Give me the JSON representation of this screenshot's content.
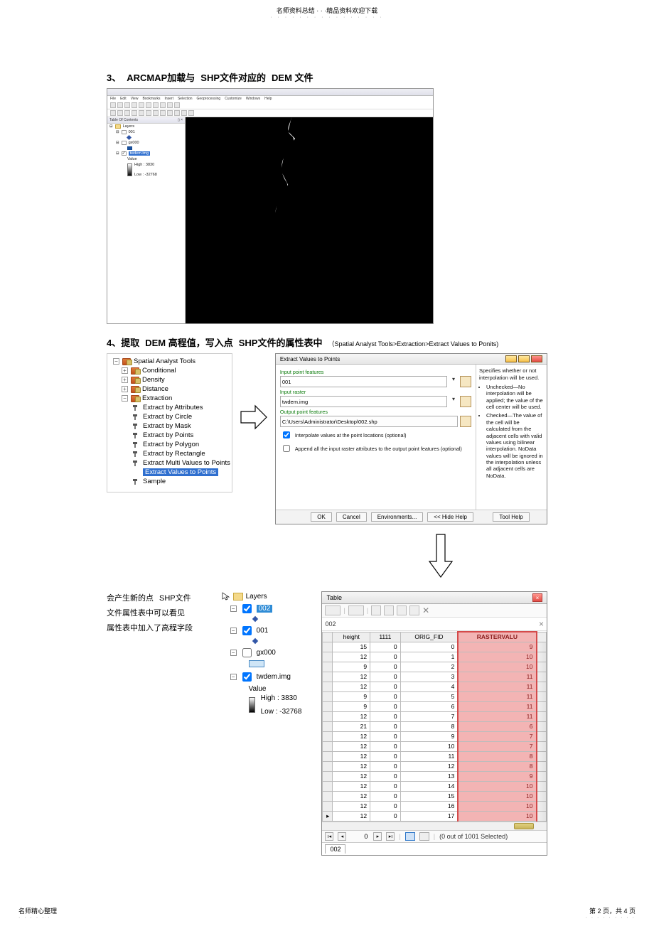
{
  "page_header": {
    "line1": "名师资料总结 · · ·精品资料欢迎下载",
    "sub": "· · · · · · · · · · · · · · · ·"
  },
  "step3": {
    "num": "3、",
    "seg1": "ARCMAP加载与",
    "seg2": "SHP文件对应的",
    "seg3": "DEM 文件"
  },
  "arcmap": {
    "menu": [
      "File",
      "Edit",
      "View",
      "Bookmarks",
      "Insert",
      "Selection",
      "Geoprocessing",
      "Customize",
      "Windows",
      "Help"
    ],
    "toc_title": "Table Of Contents",
    "toc_pin": "▯ ×",
    "layers_label": "Layers",
    "item1": "001",
    "item2": "gx000",
    "sel_item": "twdem.img",
    "value_label": "Value",
    "high": "High : 3830",
    "low": "Low : -32768"
  },
  "step4": {
    "num": "4、提取",
    "seg1": "DEM 高程值，写入点",
    "seg2": "SHP文件的属性表中",
    "note": "（Spatial Analyst Tools>Extraction>Extract Values to Ponits)"
  },
  "toolbox": {
    "root": "Spatial Analyst Tools",
    "groups": [
      "Conditional",
      "Density",
      "Distance",
      "Extraction"
    ],
    "tools": [
      "Extract by Attributes",
      "Extract by Circle",
      "Extract by Mask",
      "Extract by Points",
      "Extract by Polygon",
      "Extract by Rectangle",
      "Extract Multi Values to Points",
      "Extract Values to Points",
      "Sample"
    ]
  },
  "dialog": {
    "title": "Extract Values to Points",
    "lbl_input_features": "Input point features",
    "val_input_features": "001",
    "lbl_input_raster": "Input raster",
    "val_input_raster": "twdem.img",
    "lbl_output": "Output point features",
    "val_output": "C:\\Users\\Administrator\\Desktop\\002.shp",
    "chk1": "Interpolate values at the point locations (optional)",
    "chk2": "Append all the input raster attributes to the output point features (optional)",
    "btn_ok": "OK",
    "btn_cancel": "Cancel",
    "btn_env": "Environments...",
    "btn_hidehelp": "<< Hide Help",
    "btn_toolhelp": "Tool Help",
    "help_top": "Specifies whether or not interpolation will be used.",
    "help_li1": "Unchecked—No interpolation will be applied; the value of the cell center will be used.",
    "help_li2": "Checked—The value of the cell will be calculated from the adjacent cells with valid values using bilinear interpolation. NoData values will be ignored in the interpolation unless all adjacent cells are NoData."
  },
  "notes": {
    "l1a": "会产生新的点",
    "l1b": "SHP文件",
    "l2": "文件属性表中可以看见",
    "l3": "属性表中加入了高程字段"
  },
  "toc2": {
    "layers": "Layers",
    "l002": "002",
    "l001": "001",
    "gx": "gx000",
    "dem": "twdem.img",
    "value": "Value",
    "high": "High : 3830",
    "low": "Low : -32768"
  },
  "table": {
    "title": "Table",
    "layer": "002",
    "headers": [
      "height",
      "1111",
      "ORIG_FID",
      "RASTERVALU"
    ],
    "rows": [
      [
        15,
        0,
        0,
        9
      ],
      [
        12,
        0,
        1,
        10
      ],
      [
        9,
        0,
        2,
        10
      ],
      [
        12,
        0,
        3,
        11
      ],
      [
        12,
        0,
        4,
        11
      ],
      [
        9,
        0,
        5,
        11
      ],
      [
        9,
        0,
        6,
        11
      ],
      [
        12,
        0,
        7,
        11
      ],
      [
        21,
        0,
        8,
        6
      ],
      [
        12,
        0,
        9,
        7
      ],
      [
        12,
        0,
        10,
        7
      ],
      [
        12,
        0,
        11,
        8
      ],
      [
        12,
        0,
        12,
        8
      ],
      [
        12,
        0,
        13,
        9
      ],
      [
        12,
        0,
        14,
        10
      ],
      [
        12,
        0,
        15,
        10
      ],
      [
        12,
        0,
        16,
        10
      ],
      [
        12,
        0,
        17,
        10
      ]
    ],
    "footer_cur": "0",
    "footer_sel": "(0 out of 1001 Selected)",
    "tab": "002"
  },
  "page_footer": {
    "left": "名师精心整理",
    "left_sub": "· · · · · ·",
    "right": "第 2 页，共 4 页",
    "right_sub": "· · · · · · · · ·"
  }
}
